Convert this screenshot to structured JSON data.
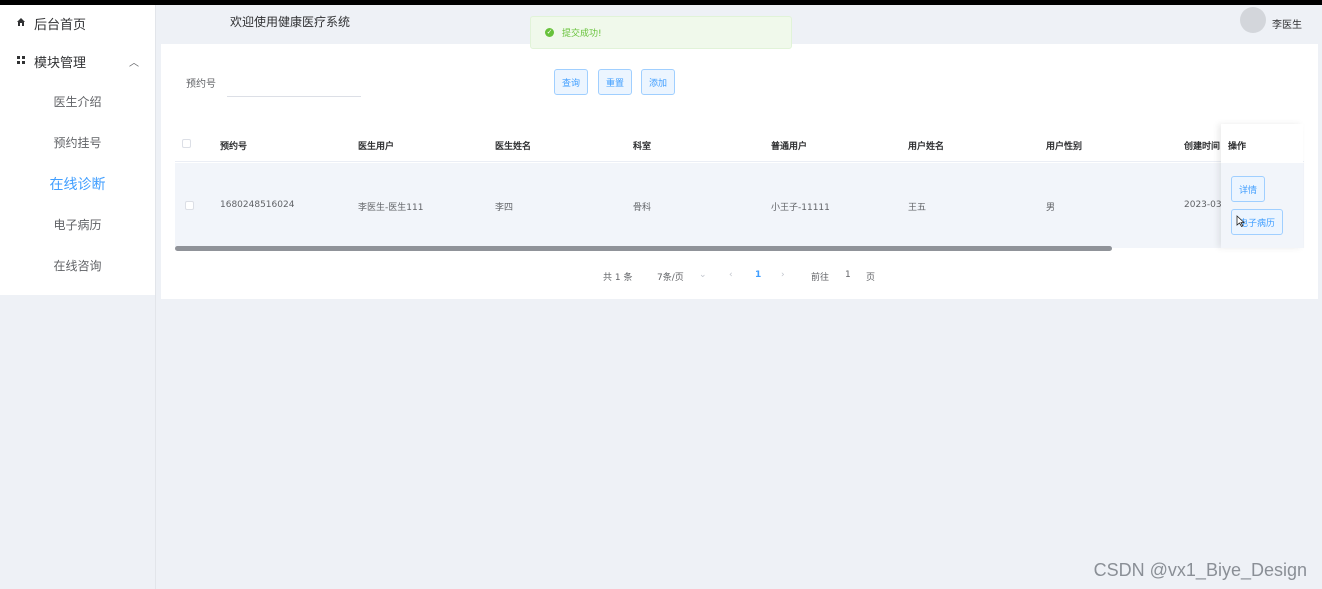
{
  "sidebar": {
    "home_label": "后台首页",
    "module_label": "模块管理",
    "items": [
      {
        "label": "医生介绍",
        "active": false
      },
      {
        "label": "预约挂号",
        "active": false
      },
      {
        "label": "在线诊断",
        "active": true
      },
      {
        "label": "电子病历",
        "active": false
      },
      {
        "label": "在线咨询",
        "active": false
      }
    ]
  },
  "header": {
    "welcome": "欢迎使用健康医疗系统",
    "user": "李医生"
  },
  "toast": {
    "message": "提交成功!"
  },
  "search": {
    "label": "预约号",
    "value": "",
    "buttons": {
      "query": "查询",
      "reset": "重置",
      "add": "添加"
    }
  },
  "table": {
    "columns": [
      "预约号",
      "医生用户",
      "医生姓名",
      "科室",
      "普通用户",
      "用户姓名",
      "用户性别",
      "创建时间",
      "操作"
    ],
    "rows": [
      {
        "appointment_no": "1680248516024",
        "doctor_user": "李医生-医生111",
        "doctor_name": "李四",
        "department": "骨科",
        "normal_user": "小王子-11111",
        "user_name": "王五",
        "user_gender": "男",
        "created_at": "2023-03-",
        "actions": [
          "详情",
          "电子病历"
        ]
      }
    ]
  },
  "pagination": {
    "total": "共 1 条",
    "page_size": "7条/页",
    "current_page": "1",
    "goto_label": "前往",
    "goto_value": "1",
    "page_suffix": "页"
  },
  "watermark": "CSDN @vx1_Biye_Design"
}
